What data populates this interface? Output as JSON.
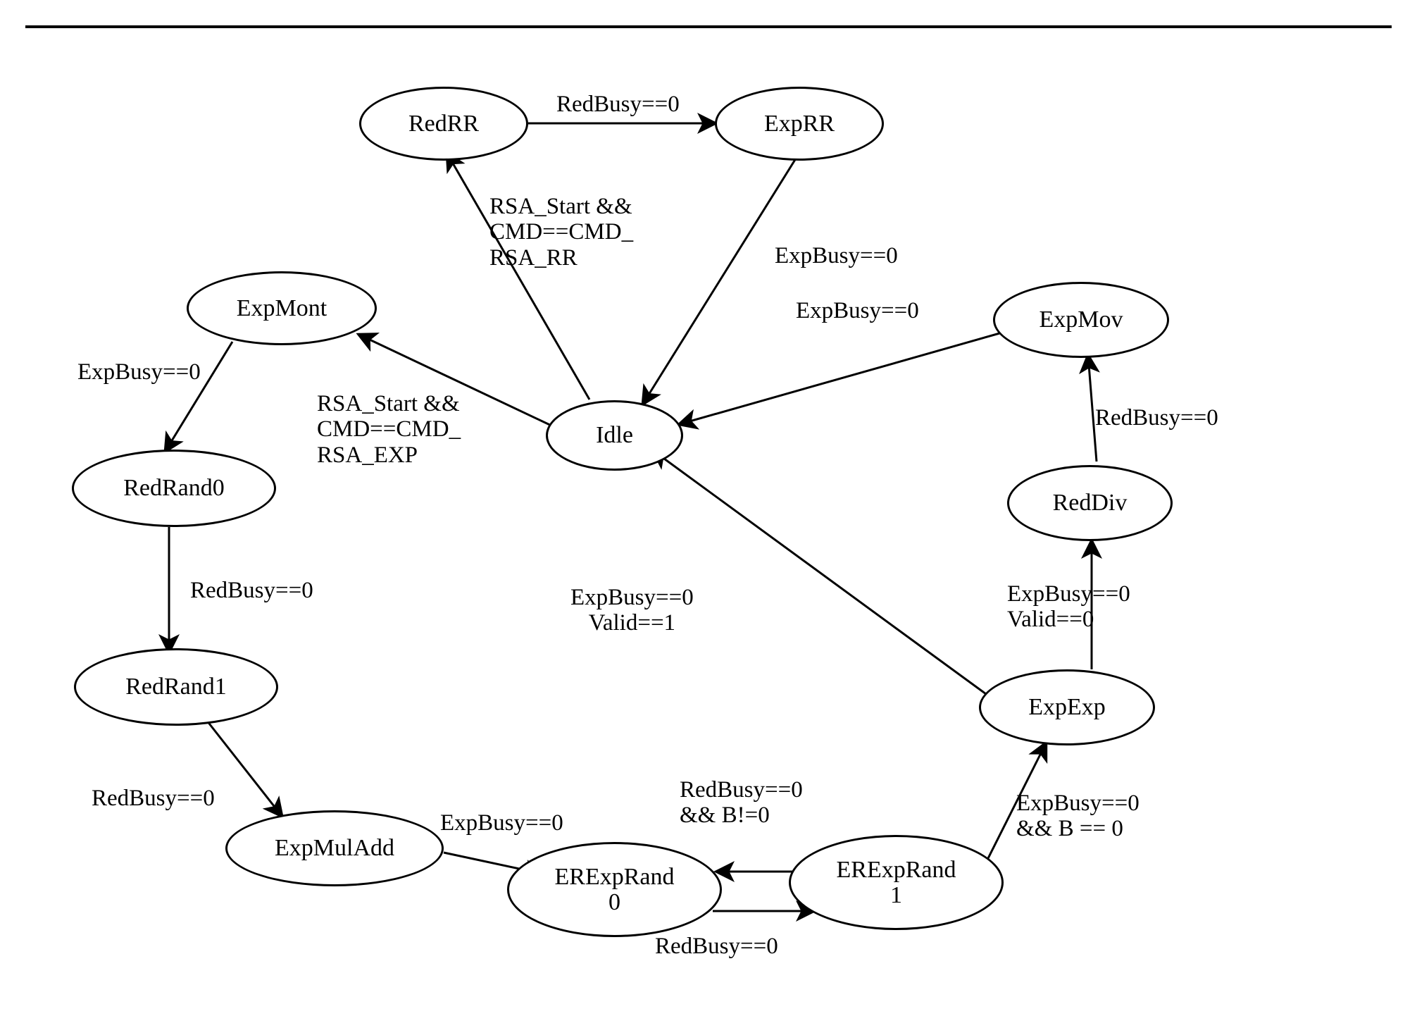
{
  "states": {
    "Idle": {
      "label": "Idle"
    },
    "RedRR": {
      "label": "RedRR"
    },
    "ExpRR": {
      "label": "ExpRR"
    },
    "ExpMont": {
      "label": "ExpMont"
    },
    "RedRand0": {
      "label": "RedRand0"
    },
    "RedRand1": {
      "label": "RedRand1"
    },
    "ExpMulAdd": {
      "label": "ExpMulAdd"
    },
    "ERExpRand0": {
      "label": "ERExpRand\n0"
    },
    "ERExpRand1": {
      "label": "ERExpRand\n1"
    },
    "ExpExp": {
      "label": "ExpExp"
    },
    "RedDiv": {
      "label": "RedDiv"
    },
    "ExpMov": {
      "label": "ExpMov"
    }
  },
  "transitions": {
    "RedRR_to_ExpRR": {
      "label": "RedBusy==0"
    },
    "Idle_to_RedRR": {
      "label": "RSA_Start &&\nCMD==CMD_\nRSA_RR"
    },
    "ExpRR_to_Idle": {
      "label": "ExpBusy==0"
    },
    "Idle_to_ExpMont": {
      "label": "RSA_Start &&\nCMD==CMD_\nRSA_EXP"
    },
    "ExpMont_to_RedRand0": {
      "label": "ExpBusy==0"
    },
    "RedRand0_to_RedRand1": {
      "label": "RedBusy==0"
    },
    "RedRand1_to_ExpMulAdd": {
      "label": "RedBusy==0"
    },
    "ExpMulAdd_to_ERExpRand0": {
      "label": "ExpBusy==0"
    },
    "ERExpRand0_to_ERExpRand1": {
      "label": "RedBusy==0"
    },
    "ERExpRand1_to_ERExpRand0": {
      "label": "RedBusy==0\n&& B!=0"
    },
    "ERExpRand1_to_ExpExp": {
      "label": "ExpBusy==0\n&& B == 0"
    },
    "ExpExp_to_RedDiv": {
      "label": "ExpBusy==0\nValid==0"
    },
    "ExpExp_to_Idle": {
      "label": "ExpBusy==0\nValid==1"
    },
    "RedDiv_to_ExpMov": {
      "label": "RedBusy==0"
    },
    "ExpMov_to_Idle": {
      "label": "ExpBusy==0"
    }
  },
  "chart_data": {
    "type": "state-machine",
    "title": "",
    "states": [
      "Idle",
      "RedRR",
      "ExpRR",
      "ExpMont",
      "RedRand0",
      "RedRand1",
      "ExpMulAdd",
      "ERExpRand0",
      "ERExpRand1",
      "ExpExp",
      "RedDiv",
      "ExpMov"
    ],
    "edges": [
      {
        "from": "Idle",
        "to": "RedRR",
        "condition": "RSA_Start && CMD==CMD_RSA_RR"
      },
      {
        "from": "RedRR",
        "to": "ExpRR",
        "condition": "RedBusy==0"
      },
      {
        "from": "ExpRR",
        "to": "Idle",
        "condition": "ExpBusy==0"
      },
      {
        "from": "Idle",
        "to": "ExpMont",
        "condition": "RSA_Start && CMD==CMD_RSA_EXP"
      },
      {
        "from": "ExpMont",
        "to": "RedRand0",
        "condition": "ExpBusy==0"
      },
      {
        "from": "RedRand0",
        "to": "RedRand1",
        "condition": "RedBusy==0"
      },
      {
        "from": "RedRand1",
        "to": "ExpMulAdd",
        "condition": "RedBusy==0"
      },
      {
        "from": "ExpMulAdd",
        "to": "ERExpRand0",
        "condition": "ExpBusy==0"
      },
      {
        "from": "ERExpRand0",
        "to": "ERExpRand1",
        "condition": "RedBusy==0"
      },
      {
        "from": "ERExpRand1",
        "to": "ERExpRand0",
        "condition": "RedBusy==0 && B!=0"
      },
      {
        "from": "ERExpRand1",
        "to": "ExpExp",
        "condition": "ExpBusy==0 && B == 0"
      },
      {
        "from": "ExpExp",
        "to": "RedDiv",
        "condition": "ExpBusy==0 Valid==0"
      },
      {
        "from": "ExpExp",
        "to": "Idle",
        "condition": "ExpBusy==0 Valid==1"
      },
      {
        "from": "RedDiv",
        "to": "ExpMov",
        "condition": "RedBusy==0"
      },
      {
        "from": "ExpMov",
        "to": "Idle",
        "condition": "ExpBusy==0"
      }
    ]
  }
}
